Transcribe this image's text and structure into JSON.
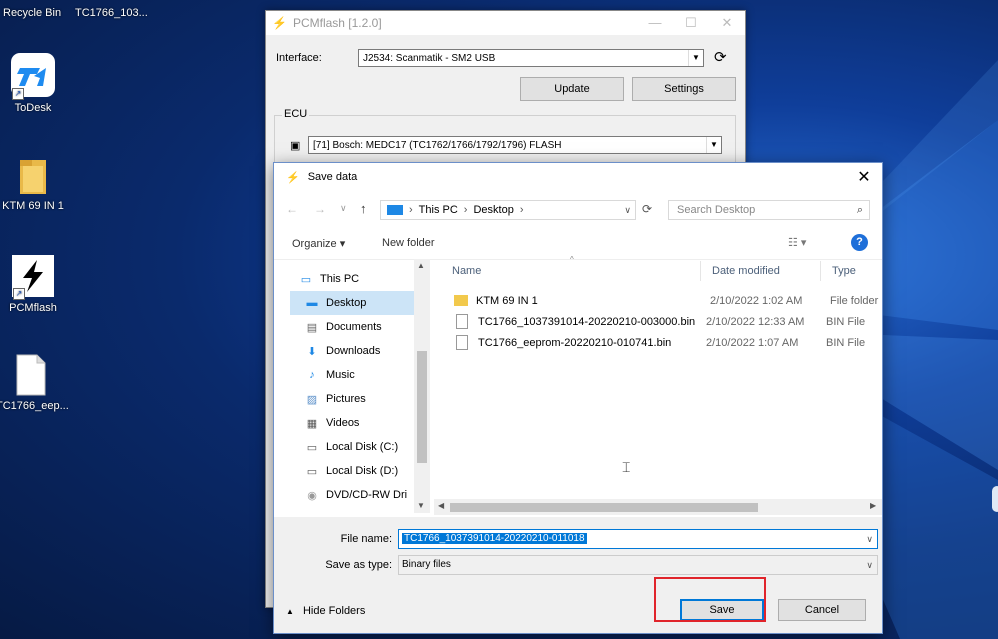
{
  "desktop": {
    "top_labels": [
      "Recycle Bin",
      "TC1766_103..."
    ],
    "icons": [
      {
        "label": "ToDesk",
        "icon": "todesk-icon"
      },
      {
        "label": "KTM 69 IN 1",
        "icon": "folder-icon"
      },
      {
        "label": "PCMflash",
        "icon": "pcmflash-icon"
      },
      {
        "label": "TC1766_eep...",
        "icon": "file-icon"
      }
    ]
  },
  "pcmflash": {
    "title": "PCMflash [1.2.0]",
    "interface_label": "Interface:",
    "interface_value": "J2534: Scanmatik - SM2 USB",
    "update_label": "Update",
    "settings_label": "Settings",
    "ecu_group": "ECU",
    "ecu_value": "[71] Bosch: MEDC17 (TC1762/1766/1792/1796) FLASH"
  },
  "dialog": {
    "title": "Save data",
    "breadcrumb": [
      "This PC",
      "Desktop"
    ],
    "search_placeholder": "Search Desktop",
    "organize_label": "Organize ▾",
    "new_folder_label": "New folder",
    "nav_items": [
      {
        "label": "This PC",
        "icon": "computer-icon",
        "indent": 0
      },
      {
        "label": "Desktop",
        "icon": "desktop-icon",
        "indent": 1,
        "selected": true
      },
      {
        "label": "Documents",
        "icon": "documents-icon",
        "indent": 1
      },
      {
        "label": "Downloads",
        "icon": "downloads-icon",
        "indent": 1
      },
      {
        "label": "Music",
        "icon": "music-icon",
        "indent": 1
      },
      {
        "label": "Pictures",
        "icon": "pictures-icon",
        "indent": 1
      },
      {
        "label": "Videos",
        "icon": "videos-icon",
        "indent": 1
      },
      {
        "label": "Local Disk (C:)",
        "icon": "disk-icon",
        "indent": 1
      },
      {
        "label": "Local Disk (D:)",
        "icon": "disk-icon",
        "indent": 1
      },
      {
        "label": "DVD/CD-RW Dri",
        "icon": "dvd-icon",
        "indent": 1
      }
    ],
    "columns": {
      "name": "Name",
      "date": "Date modified",
      "type": "Type"
    },
    "files": [
      {
        "name": "KTM 69 IN 1",
        "date": "2/10/2022 1:02 AM",
        "type": "File folder",
        "icon": "folder-icon"
      },
      {
        "name": "TC1766_1037391014-20220210-003000.bin",
        "date": "2/10/2022 12:33 AM",
        "type": "BIN File",
        "icon": "file-icon"
      },
      {
        "name": "TC1766_eeprom-20220210-010741.bin",
        "date": "2/10/2022 1:07 AM",
        "type": "BIN File",
        "icon": "file-icon"
      }
    ],
    "filename_label": "File name:",
    "filename_value": "TC1766_1037391014-20220210-011018",
    "savetype_label": "Save as type:",
    "savetype_value": "Binary files",
    "hide_folders_label": "Hide Folders",
    "save_label": "Save",
    "cancel_label": "Cancel"
  }
}
